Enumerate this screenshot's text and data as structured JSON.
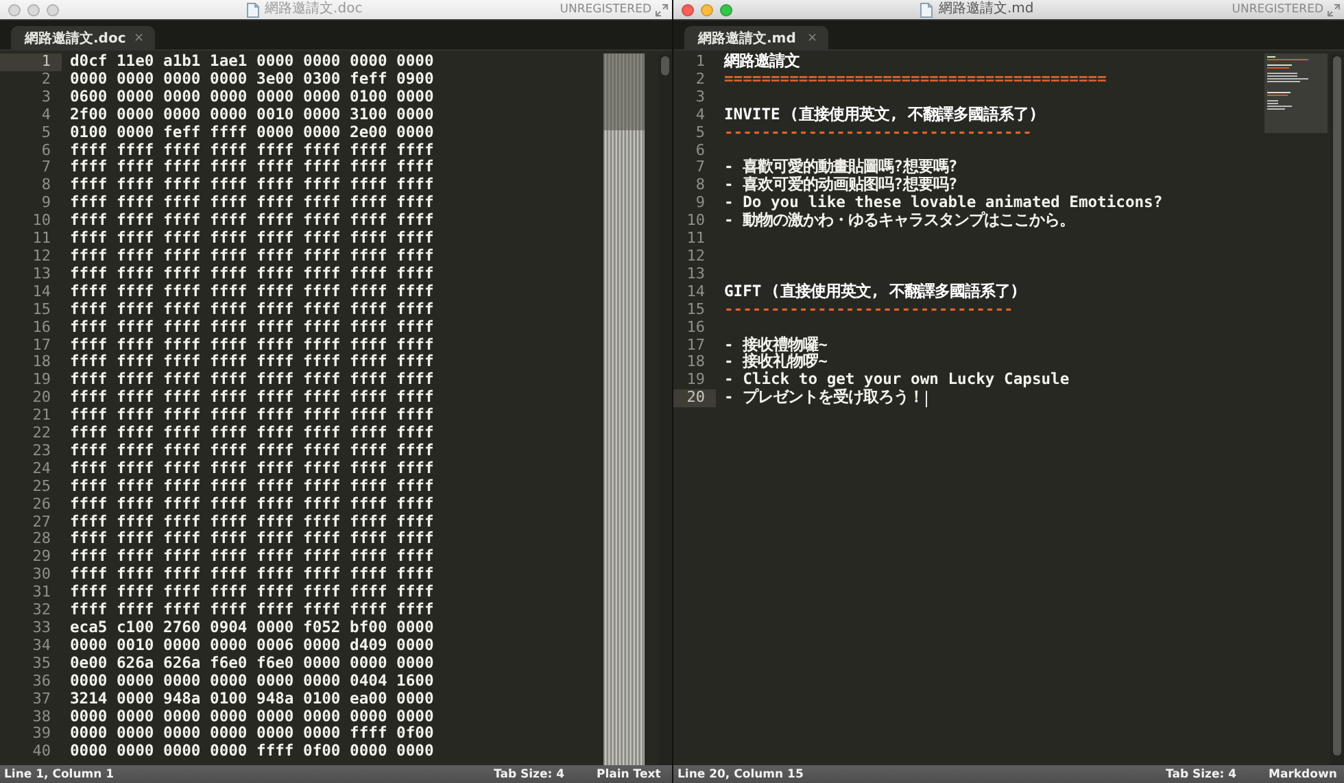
{
  "windows": [
    {
      "title": "網路邀請文.doc",
      "active": false,
      "badge": "UNREGISTERED",
      "tab": {
        "label": "網路邀請文.doc",
        "close": "×"
      },
      "lines": [
        {
          "number": "1",
          "kind": "plain",
          "current": true,
          "text": "d0cf 11e0 a1b1 1ae1 0000 0000 0000 0000"
        },
        {
          "number": "2",
          "kind": "plain",
          "current": false,
          "text": "0000 0000 0000 0000 3e00 0300 feff 0900"
        },
        {
          "number": "3",
          "kind": "plain",
          "current": false,
          "text": "0600 0000 0000 0000 0000 0000 0100 0000"
        },
        {
          "number": "4",
          "kind": "plain",
          "current": false,
          "text": "2f00 0000 0000 0000 0010 0000 3100 0000"
        },
        {
          "number": "5",
          "kind": "plain",
          "current": false,
          "text": "0100 0000 feff ffff 0000 0000 2e00 0000"
        },
        {
          "number": "6",
          "kind": "plain",
          "current": false,
          "text": "ffff ffff ffff ffff ffff ffff ffff ffff"
        },
        {
          "number": "7",
          "kind": "plain",
          "current": false,
          "text": "ffff ffff ffff ffff ffff ffff ffff ffff"
        },
        {
          "number": "8",
          "kind": "plain",
          "current": false,
          "text": "ffff ffff ffff ffff ffff ffff ffff ffff"
        },
        {
          "number": "9",
          "kind": "plain",
          "current": false,
          "text": "ffff ffff ffff ffff ffff ffff ffff ffff"
        },
        {
          "number": "10",
          "kind": "plain",
          "current": false,
          "text": "ffff ffff ffff ffff ffff ffff ffff ffff"
        },
        {
          "number": "11",
          "kind": "plain",
          "current": false,
          "text": "ffff ffff ffff ffff ffff ffff ffff ffff"
        },
        {
          "number": "12",
          "kind": "plain",
          "current": false,
          "text": "ffff ffff ffff ffff ffff ffff ffff ffff"
        },
        {
          "number": "13",
          "kind": "plain",
          "current": false,
          "text": "ffff ffff ffff ffff ffff ffff ffff ffff"
        },
        {
          "number": "14",
          "kind": "plain",
          "current": false,
          "text": "ffff ffff ffff ffff ffff ffff ffff ffff"
        },
        {
          "number": "15",
          "kind": "plain",
          "current": false,
          "text": "ffff ffff ffff ffff ffff ffff ffff ffff"
        },
        {
          "number": "16",
          "kind": "plain",
          "current": false,
          "text": "ffff ffff ffff ffff ffff ffff ffff ffff"
        },
        {
          "number": "17",
          "kind": "plain",
          "current": false,
          "text": "ffff ffff ffff ffff ffff ffff ffff ffff"
        },
        {
          "number": "18",
          "kind": "plain",
          "current": false,
          "text": "ffff ffff ffff ffff ffff ffff ffff ffff"
        },
        {
          "number": "19",
          "kind": "plain",
          "current": false,
          "text": "ffff ffff ffff ffff ffff ffff ffff ffff"
        },
        {
          "number": "20",
          "kind": "plain",
          "current": false,
          "text": "ffff ffff ffff ffff ffff ffff ffff ffff"
        },
        {
          "number": "21",
          "kind": "plain",
          "current": false,
          "text": "ffff ffff ffff ffff ffff ffff ffff ffff"
        },
        {
          "number": "22",
          "kind": "plain",
          "current": false,
          "text": "ffff ffff ffff ffff ffff ffff ffff ffff"
        },
        {
          "number": "23",
          "kind": "plain",
          "current": false,
          "text": "ffff ffff ffff ffff ffff ffff ffff ffff"
        },
        {
          "number": "24",
          "kind": "plain",
          "current": false,
          "text": "ffff ffff ffff ffff ffff ffff ffff ffff"
        },
        {
          "number": "25",
          "kind": "plain",
          "current": false,
          "text": "ffff ffff ffff ffff ffff ffff ffff ffff"
        },
        {
          "number": "26",
          "kind": "plain",
          "current": false,
          "text": "ffff ffff ffff ffff ffff ffff ffff ffff"
        },
        {
          "number": "27",
          "kind": "plain",
          "current": false,
          "text": "ffff ffff ffff ffff ffff ffff ffff ffff"
        },
        {
          "number": "28",
          "kind": "plain",
          "current": false,
          "text": "ffff ffff ffff ffff ffff ffff ffff ffff"
        },
        {
          "number": "29",
          "kind": "plain",
          "current": false,
          "text": "ffff ffff ffff ffff ffff ffff ffff ffff"
        },
        {
          "number": "30",
          "kind": "plain",
          "current": false,
          "text": "ffff ffff ffff ffff ffff ffff ffff ffff"
        },
        {
          "number": "31",
          "kind": "plain",
          "current": false,
          "text": "ffff ffff ffff ffff ffff ffff ffff ffff"
        },
        {
          "number": "32",
          "kind": "plain",
          "current": false,
          "text": "ffff ffff ffff ffff ffff ffff ffff ffff"
        },
        {
          "number": "33",
          "kind": "plain",
          "current": false,
          "text": "eca5 c100 2760 0904 0000 f052 bf00 0000"
        },
        {
          "number": "34",
          "kind": "plain",
          "current": false,
          "text": "0000 0010 0000 0000 0006 0000 d409 0000"
        },
        {
          "number": "35",
          "kind": "plain",
          "current": false,
          "text": "0e00 626a 626a f6e0 f6e0 0000 0000 0000"
        },
        {
          "number": "36",
          "kind": "plain",
          "current": false,
          "text": "0000 0000 0000 0000 0000 0000 0404 1600"
        },
        {
          "number": "37",
          "kind": "plain",
          "current": false,
          "text": "3214 0000 948a 0100 948a 0100 ea00 0000"
        },
        {
          "number": "38",
          "kind": "plain",
          "current": false,
          "text": "0000 0000 0000 0000 0000 0000 0000 0000"
        },
        {
          "number": "39",
          "kind": "plain",
          "current": false,
          "text": "0000 0000 0000 0000 0000 0000 ffff 0f00"
        },
        {
          "number": "40",
          "kind": "plain",
          "current": false,
          "text": "0000 0000 0000 0000 ffff 0f00 0000 0000"
        }
      ],
      "status": {
        "position": "Line 1, Column 1",
        "tab_size": "Tab Size: 4",
        "syntax": "Plain Text"
      }
    },
    {
      "title": "網路邀請文.md",
      "active": true,
      "badge": "UNREGISTERED",
      "tab": {
        "label": "網路邀請文.md",
        "close": "×"
      },
      "lines": [
        {
          "number": "1",
          "kind": "heading",
          "current": false,
          "text": "網路邀請文"
        },
        {
          "number": "2",
          "kind": "rule",
          "current": false,
          "text": "========================================="
        },
        {
          "number": "3",
          "kind": "blank",
          "current": false
        },
        {
          "number": "4",
          "kind": "heading",
          "current": false,
          "text": "INVITE (直接使用英文, 不翻譯多國語系了)"
        },
        {
          "number": "5",
          "kind": "rule",
          "current": false,
          "text": "---------------------------------"
        },
        {
          "number": "6",
          "kind": "blank",
          "current": false
        },
        {
          "number": "7",
          "kind": "plain",
          "current": false,
          "text": "- 喜歡可愛的動畫貼圖嗎?想要嗎?"
        },
        {
          "number": "8",
          "kind": "plain",
          "current": false,
          "text": "- 喜欢可爱的动画贴图吗?想要吗?"
        },
        {
          "number": "9",
          "kind": "plain",
          "current": false,
          "text": "- Do you like these lovable animated Emoticons?"
        },
        {
          "number": "10",
          "kind": "plain",
          "current": false,
          "text": "- 動物の激かわ・ゆるキャラスタンプはここから。"
        },
        {
          "number": "11",
          "kind": "blank",
          "current": false
        },
        {
          "number": "12",
          "kind": "blank",
          "current": false
        },
        {
          "number": "13",
          "kind": "blank",
          "current": false
        },
        {
          "number": "14",
          "kind": "heading",
          "current": false,
          "text": "GIFT (直接使用英文, 不翻譯多國語系了)"
        },
        {
          "number": "15",
          "kind": "rule",
          "current": false,
          "text": "-------------------------------"
        },
        {
          "number": "16",
          "kind": "blank",
          "current": false
        },
        {
          "number": "17",
          "kind": "plain",
          "current": false,
          "text": "- 接收禮物囉~"
        },
        {
          "number": "18",
          "kind": "plain",
          "current": false,
          "text": "- 接收礼物啰~"
        },
        {
          "number": "19",
          "kind": "plain",
          "current": false,
          "text": "- Click to get your own Lucky Capsule"
        },
        {
          "number": "20",
          "kind": "plain",
          "current": true,
          "text": "- プレゼントを受け取ろう！"
        }
      ],
      "status": {
        "position": "Line 20, Column 15",
        "tab_size": "Tab Size: 4",
        "syntax": "Markdown"
      }
    }
  ]
}
